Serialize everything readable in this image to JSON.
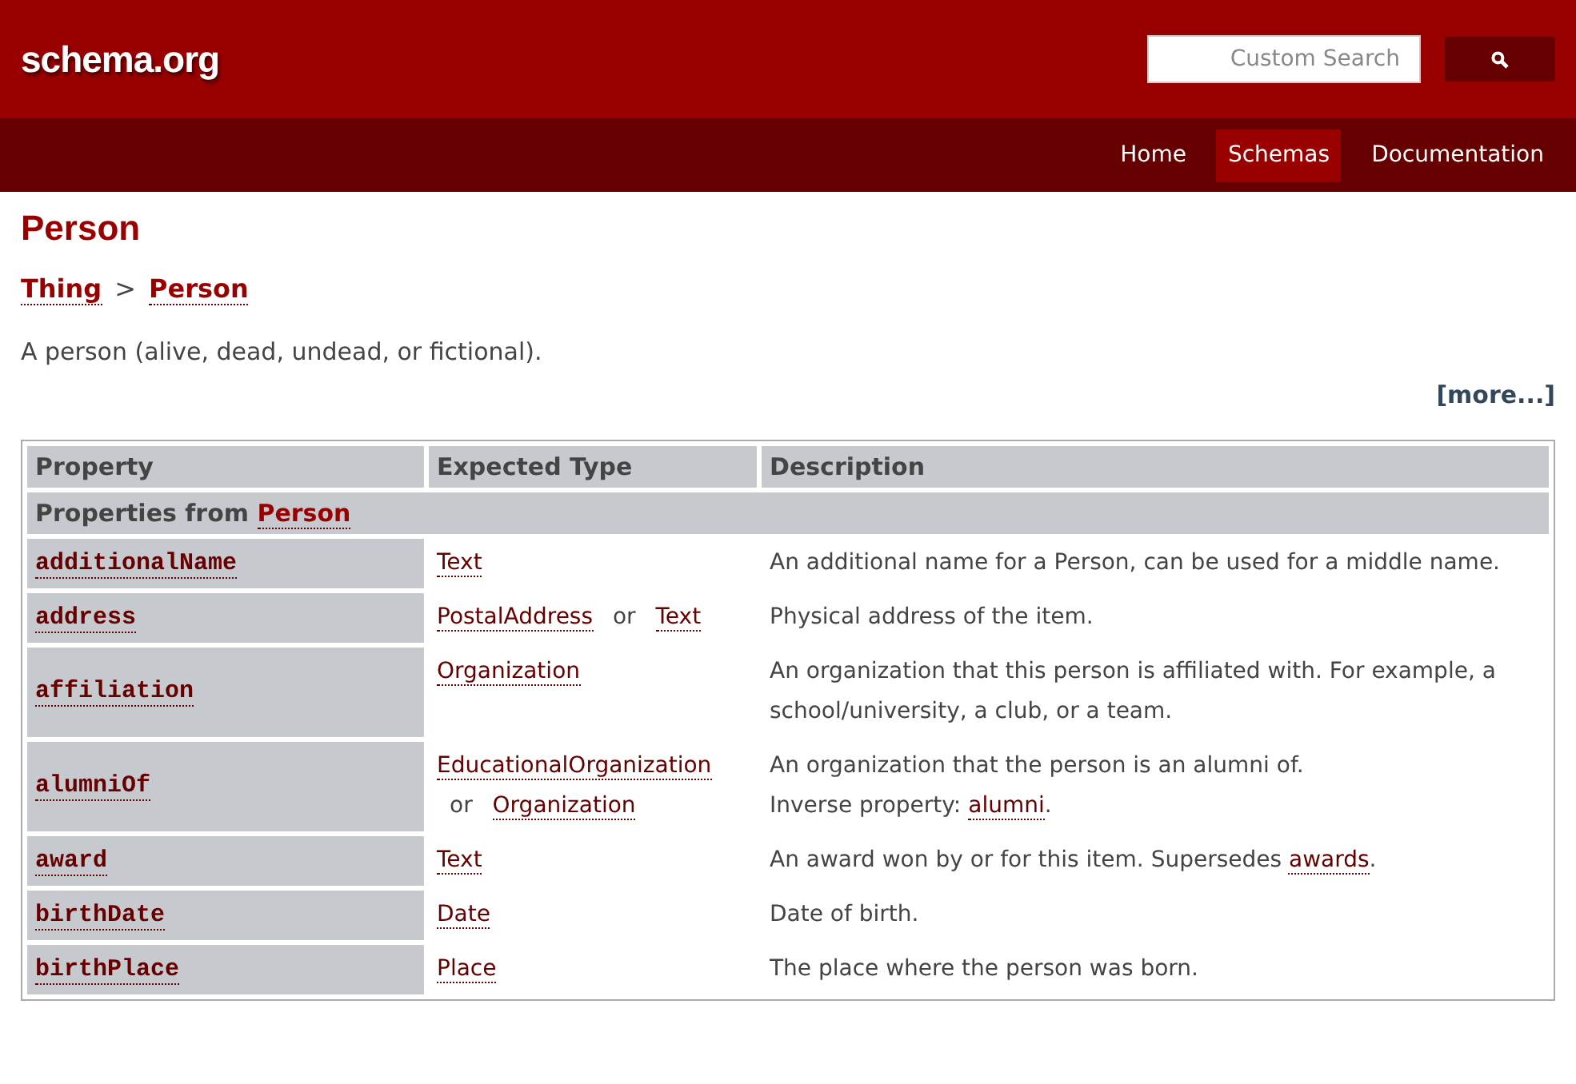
{
  "header": {
    "logo": "schema.org",
    "search": {
      "placeholder": "Custom Search"
    }
  },
  "nav": [
    {
      "label": "Home",
      "selected": false
    },
    {
      "label": "Schemas",
      "selected": true
    },
    {
      "label": "Documentation",
      "selected": false
    }
  ],
  "page": {
    "title": "Person",
    "breadcrumb": [
      {
        "kind": "link",
        "text": "Thing"
      },
      {
        "kind": "sep",
        "text": ">"
      },
      {
        "kind": "link",
        "text": "Person"
      }
    ],
    "description": "A person (alive, dead, undead, or fictional).",
    "more": "[more...]"
  },
  "table": {
    "columns": [
      "Property",
      "Expected Type",
      "Description"
    ],
    "section": {
      "label": "Properties from",
      "link": "Person"
    },
    "rows": [
      {
        "property": "additionalName",
        "types": [
          {
            "kind": "link",
            "text": "Text"
          }
        ],
        "description": [
          {
            "kind": "text",
            "text": "An additional name for a Person, can be used for a middle name."
          }
        ]
      },
      {
        "property": "address",
        "types": [
          {
            "kind": "link",
            "text": "PostalAddress"
          },
          {
            "kind": "or",
            "text": "or"
          },
          {
            "kind": "link",
            "text": "Text"
          }
        ],
        "description": [
          {
            "kind": "text",
            "text": "Physical address of the item."
          }
        ]
      },
      {
        "property": "affiliation",
        "types": [
          {
            "kind": "link",
            "text": "Organization"
          }
        ],
        "description": [
          {
            "kind": "text",
            "text": "An organization that this person is affiliated with. For example, a school/university, a club, or a team."
          }
        ]
      },
      {
        "property": "alumniOf",
        "types": [
          {
            "kind": "link",
            "text": "EducationalOrganization"
          },
          {
            "kind": "or",
            "text": "or"
          },
          {
            "kind": "link",
            "text": "Organization"
          }
        ],
        "description": [
          {
            "kind": "text",
            "text": "An organization that the person is an alumni of."
          },
          {
            "kind": "break",
            "text": "Inverse property:"
          },
          {
            "kind": "link",
            "text": "alumni"
          },
          {
            "kind": "text",
            "text": "."
          }
        ]
      },
      {
        "property": "award",
        "types": [
          {
            "kind": "link",
            "text": "Text"
          }
        ],
        "description": [
          {
            "kind": "text",
            "text": "An award won by or for this item. Supersedes"
          },
          {
            "kind": "link",
            "text": "awards"
          },
          {
            "kind": "text",
            "text": "."
          }
        ]
      },
      {
        "property": "birthDate",
        "types": [
          {
            "kind": "link",
            "text": "Date"
          }
        ],
        "description": [
          {
            "kind": "text",
            "text": "Date of birth."
          }
        ]
      },
      {
        "property": "birthPlace",
        "types": [
          {
            "kind": "link",
            "text": "Place"
          }
        ],
        "description": [
          {
            "kind": "text",
            "text": "The place where the person was born."
          }
        ]
      }
    ]
  }
}
